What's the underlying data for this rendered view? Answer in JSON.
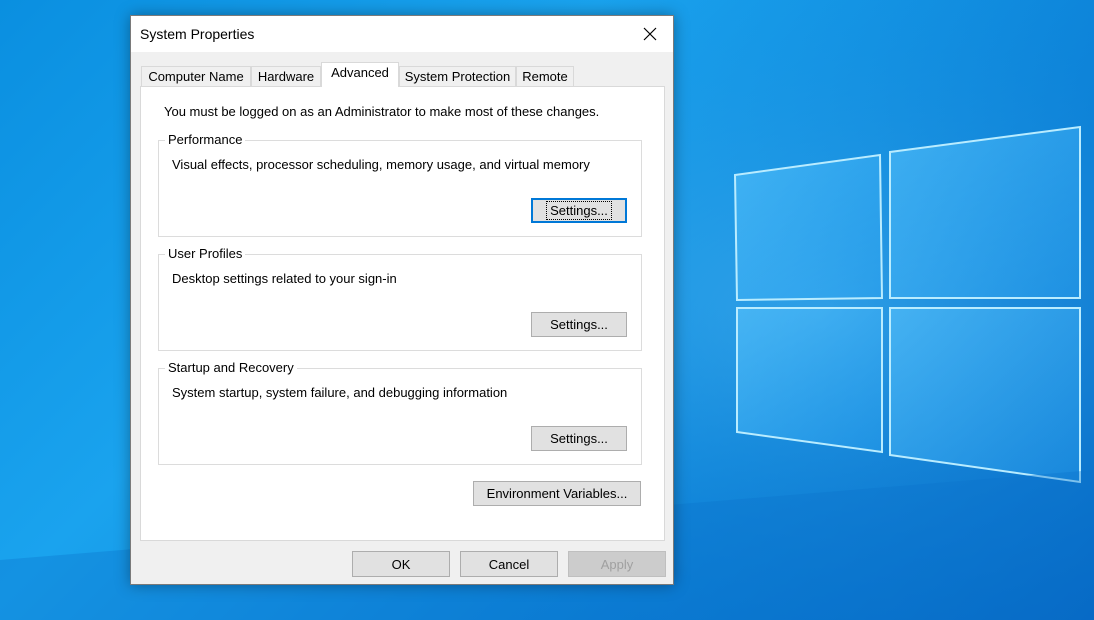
{
  "dialog": {
    "title": "System Properties",
    "tabs": [
      {
        "label": "Computer Name",
        "active": false
      },
      {
        "label": "Hardware",
        "active": false
      },
      {
        "label": "Advanced",
        "active": true
      },
      {
        "label": "System Protection",
        "active": false
      },
      {
        "label": "Remote",
        "active": false
      }
    ],
    "notice": "You must be logged on as an Administrator to make most of these changes.",
    "groups": [
      {
        "label": "Performance",
        "description": "Visual effects, processor scheduling, memory usage, and virtual memory",
        "button": "Settings..."
      },
      {
        "label": "User Profiles",
        "description": "Desktop settings related to your sign-in",
        "button": "Settings..."
      },
      {
        "label": "Startup and Recovery",
        "description": "System startup, system failure, and debugging information",
        "button": "Settings..."
      }
    ],
    "env_button": "Environment Variables...",
    "footer": {
      "ok": "OK",
      "cancel": "Cancel",
      "apply": "Apply"
    }
  },
  "colors": {
    "accent": "#0078d7",
    "desktop": "#0a8fe0"
  },
  "icons": {
    "close": "close-icon",
    "wallpaper": "windows-logo"
  }
}
